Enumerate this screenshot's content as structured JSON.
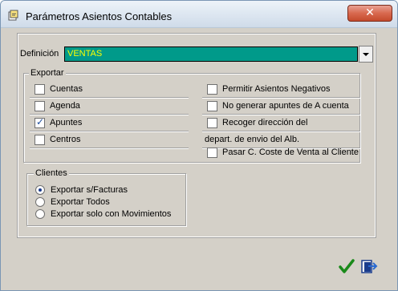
{
  "window": {
    "title": "Parámetros Asientos Contables",
    "close_label": "✕"
  },
  "definicion": {
    "label": "Definición",
    "value": "VENTAS"
  },
  "exportar": {
    "title": "Exportar",
    "left_items": [
      {
        "label": "Cuentas",
        "checked": false
      },
      {
        "label": "Agenda",
        "checked": false
      },
      {
        "label": "Apuntes",
        "checked": true
      },
      {
        "label": "Centros",
        "checked": false
      }
    ],
    "right_items": [
      {
        "label": "Permitir Asientos Negativos",
        "checked": false
      },
      {
        "label": "No generar apuntes de A cuenta",
        "checked": false
      },
      {
        "label": "Recoger dirección del",
        "checked": false
      },
      {
        "label": "depart. de envio del Alb.",
        "checked": null
      },
      {
        "label": "Pasar C. Coste de Venta al Cliente",
        "checked": false
      }
    ]
  },
  "clientes": {
    "title": "Clientes",
    "options": [
      {
        "label": "Exportar s/Facturas",
        "selected": true
      },
      {
        "label": "Exportar Todos",
        "selected": false
      },
      {
        "label": "Exportar solo con Movimientos",
        "selected": false
      }
    ]
  },
  "footer": {
    "ok_icon": "checkmark-icon",
    "exit_icon": "exit-icon"
  },
  "colors": {
    "combo_bg": "#009a8a",
    "combo_text": "#ffff00",
    "ok_green": "#1a8a1a"
  }
}
